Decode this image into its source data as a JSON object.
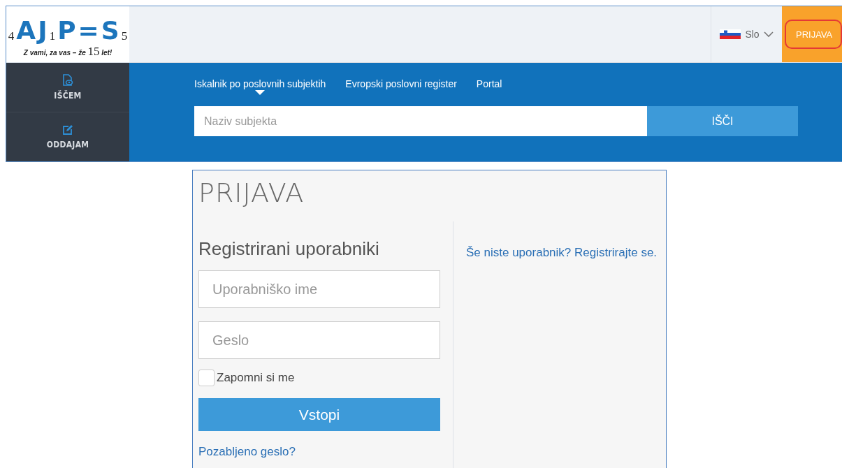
{
  "logo": {
    "letters": [
      {
        "text": "4",
        "kind": "digit"
      },
      {
        "text": "A",
        "kind": "letter"
      },
      {
        "text": "J",
        "kind": "letter"
      },
      {
        "text": "1",
        "kind": "digit"
      },
      {
        "text": "P",
        "kind": "letter"
      },
      {
        "text": "=",
        "kind": "letter"
      },
      {
        "text": "S",
        "kind": "letter"
      },
      {
        "text": "5",
        "kind": "digit"
      }
    ],
    "tagline": "Z vami, za vas – že",
    "tagline_number": "15",
    "tagline_end": "let!"
  },
  "language": {
    "label": "Slo"
  },
  "login_button": {
    "label": "PRIJAVA",
    "highlighted": true
  },
  "sidebar": {
    "items": [
      {
        "label": "IŠČEM",
        "kind": "search"
      },
      {
        "label": "ODDAJAM",
        "kind": "submit"
      }
    ]
  },
  "tabs": [
    {
      "label": "Iskalnik po poslovnih subjektih",
      "selected": true
    },
    {
      "label": "Evropski poslovni register",
      "selected": false
    },
    {
      "label": "Portal",
      "selected": false
    }
  ],
  "search": {
    "placeholder": "Naziv subjekta",
    "button": "IŠČI"
  },
  "login": {
    "title": "PRIJAVA",
    "heading": "Registrirani uporabniki",
    "username_placeholder": "Uporabniško ime",
    "password_placeholder": "Geslo",
    "remember": {
      "label": "Zapomni si me",
      "checked": false
    },
    "submit": "Vstopi",
    "forgot": "Pozabljeno geslo?",
    "register": "Še niste uporabnik? Registrirajte se."
  }
}
